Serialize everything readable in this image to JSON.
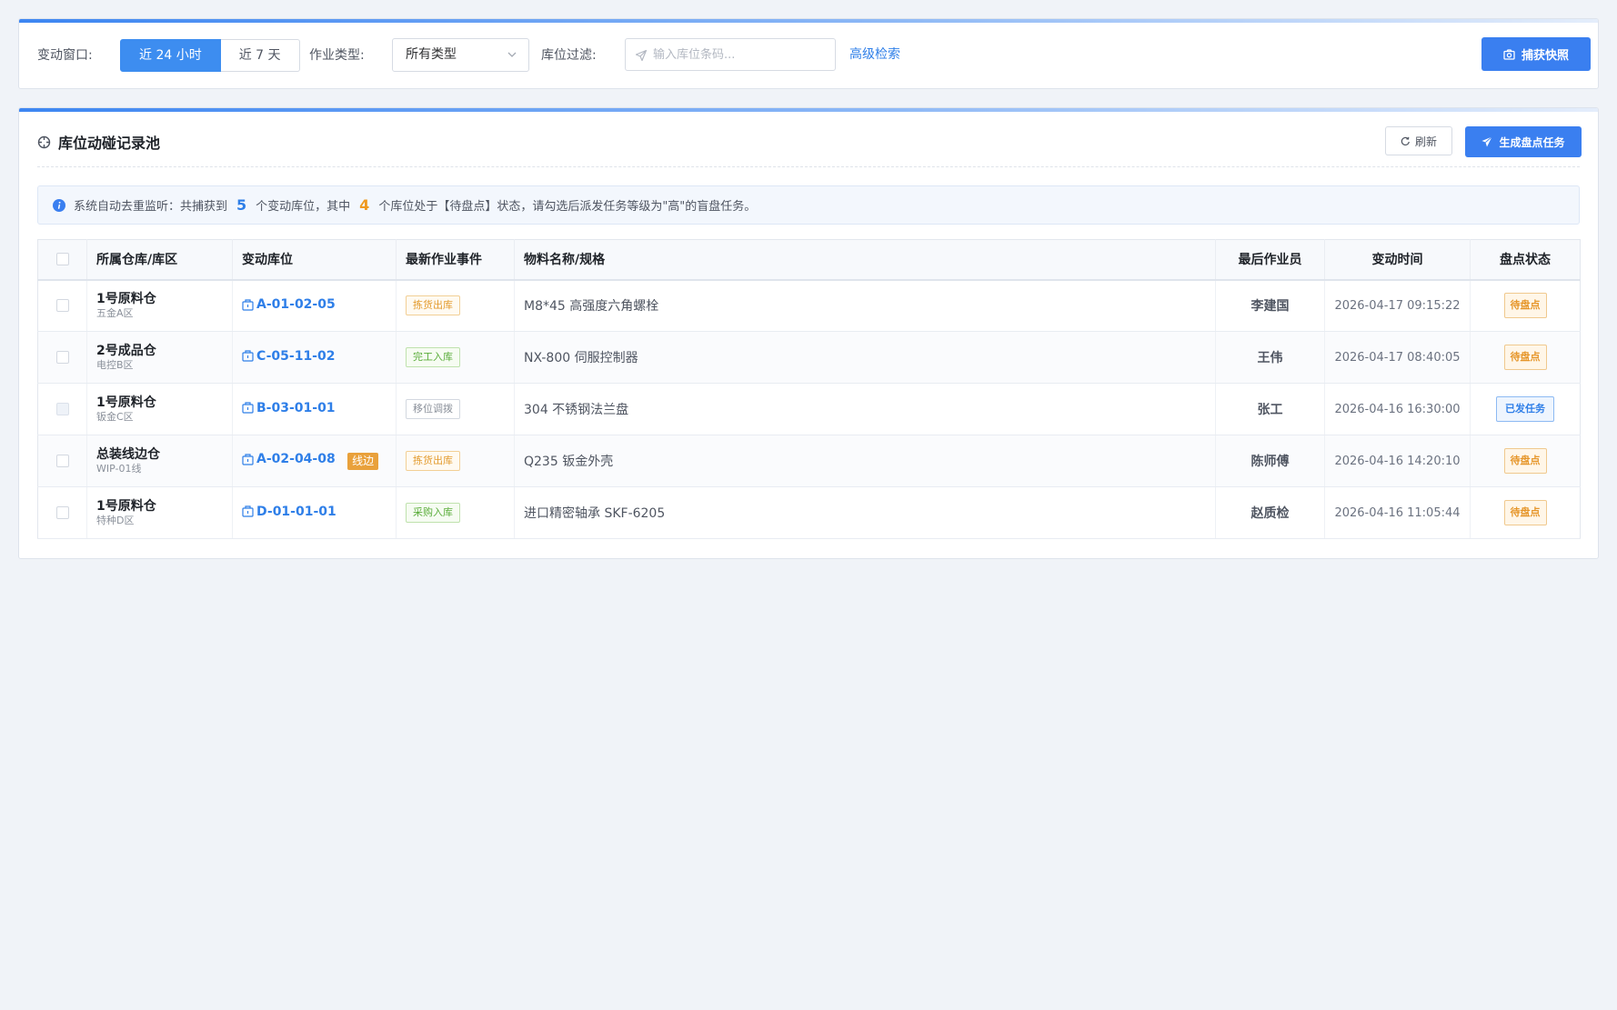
{
  "filters": {
    "window_label": "变动窗口:",
    "window_options": [
      "近 24 小时",
      "近 7 天"
    ],
    "job_type_label": "作业类型:",
    "job_type_value": "所有类型",
    "location_label": "库位过滤:",
    "location_placeholder": "输入库位条码...",
    "advanced_search": "高级检索",
    "snapshot_button": "捕获快照"
  },
  "panel": {
    "title": "库位动碰记录池",
    "refresh_button": "刷新",
    "generate_button": "生成盘点任务"
  },
  "notice": {
    "text_1": "系统自动去重监听：共捕获到",
    "count_changed": "5",
    "text_2": "个变动库位，其中",
    "count_pending": "4",
    "text_3": "个库位处于【待盘点】状态，请勾选后派发任务等级为\"高\"的盲盘任务。"
  },
  "table": {
    "headers": {
      "warehouse": "所属仓库/库区",
      "location": "变动库位",
      "event": "最新作业事件",
      "material": "物料名称/规格",
      "operator": "最后作业员",
      "time": "变动时间",
      "status": "盘点状态"
    },
    "rows": [
      {
        "warehouse": "1号原料仓",
        "zone": "五金A区",
        "location": "A-01-02-05",
        "badge": "",
        "event": "拣货出库",
        "material": "M8*45 高强度六角螺栓",
        "operator": "李建国",
        "time": "2026-04-17 09:15:22",
        "status": "待盘点"
      },
      {
        "warehouse": "2号成品仓",
        "zone": "电控B区",
        "location": "C-05-11-02",
        "badge": "",
        "event": "完工入库",
        "material": "NX-800 伺服控制器",
        "operator": "王伟",
        "time": "2026-04-17 08:40:05",
        "status": "待盘点"
      },
      {
        "warehouse": "1号原料仓",
        "zone": "钣金C区",
        "location": "B-03-01-01",
        "badge": "",
        "event": "移位调拨",
        "material": "304 不锈钢法兰盘",
        "operator": "张工",
        "time": "2026-04-16 16:30:00",
        "status": "已发任务"
      },
      {
        "warehouse": "总装线边仓",
        "zone": "WIP-01线",
        "location": "A-02-04-08",
        "badge": "线边",
        "event": "拣货出库",
        "material": "Q235 钣金外壳",
        "operator": "陈师傅",
        "time": "2026-04-16 14:20:10",
        "status": "待盘点"
      },
      {
        "warehouse": "1号原料仓",
        "zone": "特种D区",
        "location": "D-01-01-01",
        "badge": "",
        "event": "采购入库",
        "material": "进口精密轴承 SKF-6205",
        "operator": "赵质检",
        "time": "2026-04-16 11:05:44",
        "status": "待盘点"
      }
    ]
  },
  "colors": {
    "primary": "#3a7ff0",
    "link": "#2f7fe8",
    "pending": "#e6962a",
    "inbound": "#5aad3a",
    "transfer": "#8a909a"
  }
}
